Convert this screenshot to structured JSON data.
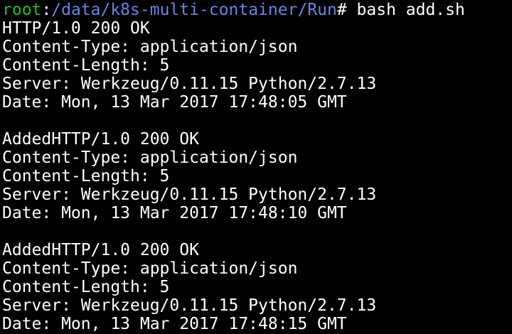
{
  "colors": {
    "background": "#000000",
    "foreground": "#ffffff",
    "prompt_user": "#20c020",
    "prompt_path": "#6b83e6"
  },
  "prompt": {
    "user": "root",
    "separator": ":",
    "path": "/data/k8s-multi-container/Run",
    "symbol": "#",
    "command": " bash add.sh"
  },
  "output": [
    "HTTP/1.0 200 OK",
    "Content-Type: application/json",
    "Content-Length: 5",
    "Server: Werkzeug/0.11.15 Python/2.7.13",
    "Date: Mon, 13 Mar 2017 17:48:05 GMT",
    "",
    "AddedHTTP/1.0 200 OK",
    "Content-Type: application/json",
    "Content-Length: 5",
    "Server: Werkzeug/0.11.15 Python/2.7.13",
    "Date: Mon, 13 Mar 2017 17:48:10 GMT",
    "",
    "AddedHTTP/1.0 200 OK",
    "Content-Type: application/json",
    "Content-Length: 5",
    "Server: Werkzeug/0.11.15 Python/2.7.13",
    "Date: Mon, 13 Mar 2017 17:48:15 GMT"
  ]
}
